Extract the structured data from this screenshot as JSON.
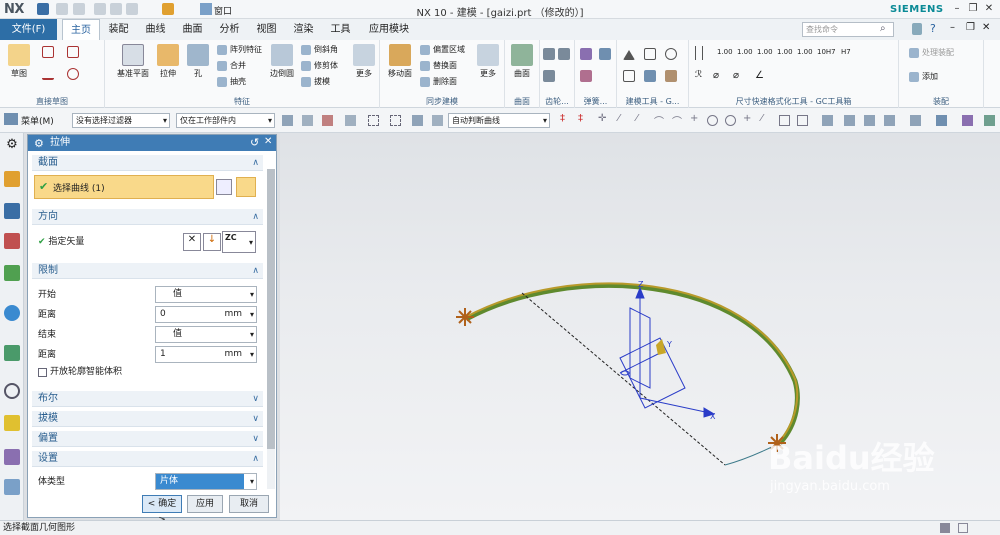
{
  "titlebar": {
    "logo": "NX",
    "window_menu": "窗口",
    "title": "NX 10 - 建模 - [gaizi.prt （修改的）]",
    "brand": "SIEMENS"
  },
  "menu": {
    "file": "文件(F)",
    "tabs": [
      "主页",
      "装配",
      "曲线",
      "曲面",
      "分析",
      "视图",
      "渲染",
      "工具",
      "应用模块"
    ],
    "active_tab": "主页",
    "search_placeholder": "查找命令"
  },
  "ribbon": {
    "direct_sketch": {
      "sketch": "草图",
      "label": "直接草图"
    },
    "feature": {
      "datum": "基准平面",
      "extrude": "拉伸",
      "hole": "孔",
      "pattern": "阵列特征",
      "unite": "合并",
      "shell": "抽壳",
      "edge_blend": "边倒圆",
      "chamfer": "倒斜角",
      "trim_body": "修剪体",
      "draft": "拔模",
      "more": "更多",
      "label": "特征"
    },
    "sync": {
      "move_face": "移动面",
      "offset_region": "偏置区域",
      "replace_face": "替换面",
      "delete_face": "删除面",
      "more": "更多",
      "label": "同步建模"
    },
    "surface": {
      "surface": "曲面",
      "label": "曲面"
    },
    "group_a": "齿轮...",
    "group_b": "弹簧...",
    "tools": "建模工具 - G...",
    "dims": {
      "label": "尺寸快速格式化工具 - GC工具箱",
      "values": [
        "1.00",
        "1.00",
        "1.00",
        "1.00",
        "1.00",
        "10H7",
        "H7"
      ]
    },
    "assembly": {
      "add": "添加",
      "component": "处理装配",
      "label": "装配"
    }
  },
  "toolbar2": {
    "menu": "菜单(M)",
    "filter": "没有选择过滤器",
    "scope": "仅在工作部件内",
    "curve_rule": "自动判断曲线"
  },
  "dialog": {
    "title": "拉伸",
    "section": {
      "label": "截面",
      "select_curve": "选择曲线 (1)"
    },
    "direction": {
      "label": "方向",
      "specify_vector": "指定矢量",
      "vector": "ZC"
    },
    "limits": {
      "label": "限制",
      "start_label": "开始",
      "start_value": "值",
      "start_dist_label": "距离",
      "start_dist": "0",
      "unit": "mm",
      "end_label": "结束",
      "end_value": "值",
      "end_dist_label": "距离",
      "end_dist": "1",
      "open_profile": "开放轮廓智能体积"
    },
    "boolean": "布尔",
    "draft": "拔模",
    "offset": "偏置",
    "settings": {
      "label": "设置",
      "body_type_label": "体类型",
      "body_type": "片体"
    },
    "buttons": {
      "ok": "< 确定 >",
      "apply": "应用",
      "cancel": "取消"
    }
  },
  "viewport": {
    "axis_z": "Z",
    "axis_x": "X",
    "axis_y": "Y",
    "curve_color": "#b89a2a",
    "surface_color": "#5f8a2e"
  },
  "watermark": {
    "brand": "Baidu经验",
    "url": "jingyan.baidu.com"
  },
  "status": {
    "text": "选择截面几何图形"
  },
  "colors": {
    "accent": "#3f7cb5",
    "file_menu": "#2d6ea6",
    "highlight": "#f9d98a",
    "check": "#2ea043"
  }
}
